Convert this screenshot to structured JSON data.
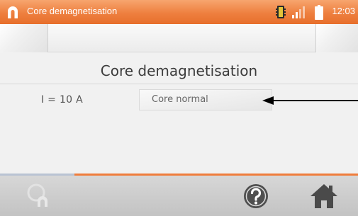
{
  "statusbar": {
    "title": "Core demagnetisation",
    "app_icon": "magnet-icon",
    "battery_icon": "battery-icon",
    "signal_icon": "signal-icon",
    "device_icon": "device-icon",
    "time": "12:03"
  },
  "main": {
    "heading": "Core demagnetisation",
    "current_label": "I = 10 A",
    "status_value": "Core normal"
  },
  "progress": {
    "fraction": 1.0
  },
  "toolbar": {
    "start_icon": "demagnetise-icon",
    "help_icon": "help-icon",
    "home_icon": "home-icon"
  },
  "colors": {
    "accent": "#ee7f3f",
    "toolbar": "#c9c9c9",
    "content_bg": "#f1f1f1"
  }
}
